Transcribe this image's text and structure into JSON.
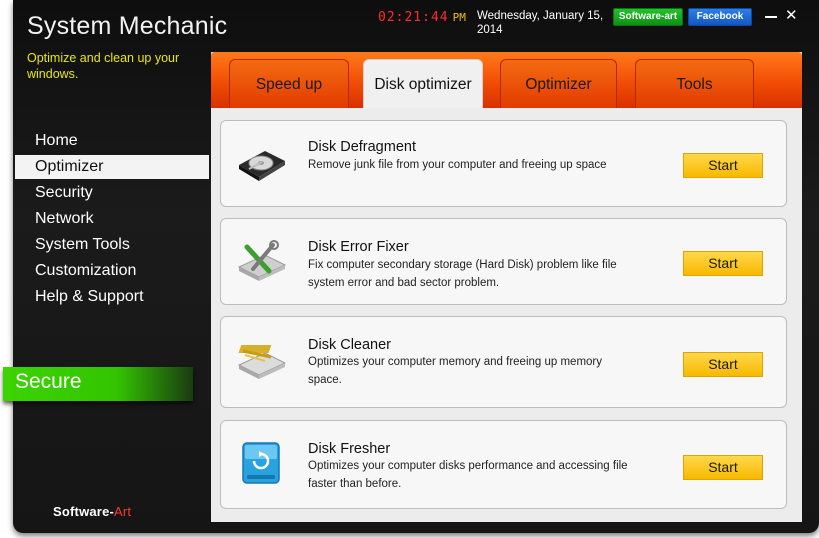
{
  "app": {
    "title": "System Mechanic",
    "subtitle": "Optimize and clean up your windows.",
    "time": "02:21:44",
    "ampm": "PM",
    "date": "Wednesday, January 15, 2014",
    "software_art_label": "Software-art",
    "facebook_label": "Facebook",
    "close_glyph": "✕"
  },
  "sidebar": {
    "items": [
      {
        "label": "Home",
        "active": false
      },
      {
        "label": "Optimizer",
        "active": true
      },
      {
        "label": "Security",
        "active": false
      },
      {
        "label": "Network",
        "active": false
      },
      {
        "label": "System Tools",
        "active": false
      },
      {
        "label": "Customization",
        "active": false
      },
      {
        "label": "Help & Support",
        "active": false
      }
    ],
    "status": "Secure"
  },
  "footer": {
    "brand": "Software-",
    "brand_accent": "Art"
  },
  "tabs": [
    {
      "label": "Speed up"
    },
    {
      "label": "Disk optimizer"
    },
    {
      "label": "Optimizer"
    },
    {
      "label": "Tools"
    }
  ],
  "active_tab": "Disk optimizer",
  "cards": [
    {
      "title": "Disk Defragment",
      "desc": "Remove junk file from your computer and freeing up space",
      "button": "Start",
      "icon": "hard-drive-icon"
    },
    {
      "title": "Disk Error Fixer",
      "desc": "Fix computer secondary storage (Hard Disk) problem like file system error and bad sector problem.",
      "button": "Start",
      "icon": "disk-repair-icon"
    },
    {
      "title": "Disk Cleaner",
      "desc": "Optimizes your computer memory and freeing up memory space.",
      "button": "Start",
      "icon": "disk-cleaner-icon"
    },
    {
      "title": "Disk Fresher",
      "desc": "Optimizes your computer disks performance and accessing file faster than before.",
      "button": "Start",
      "icon": "disk-refresh-icon"
    }
  ],
  "colors": {
    "accent_orange": "#f24d05",
    "start_yellow": "#f7b900",
    "secure_green": "#3cd400",
    "clock_red": "#ff2a2a"
  }
}
